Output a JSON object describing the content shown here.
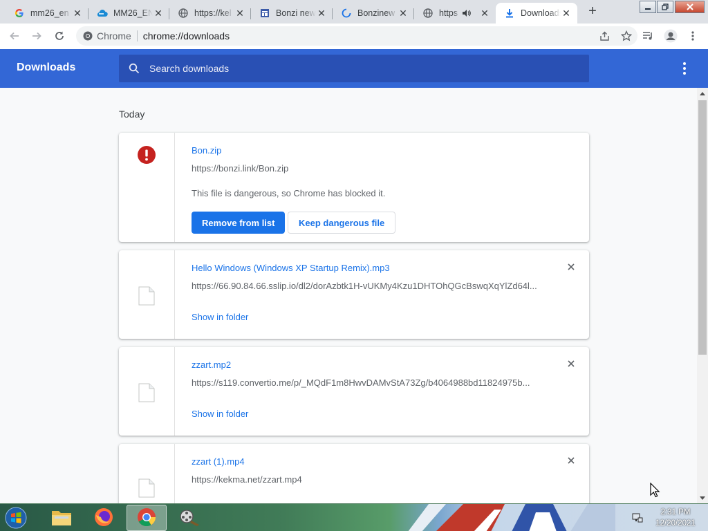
{
  "browser": {
    "tabs": [
      {
        "title": "mm26_en",
        "favicon": "google-g-icon"
      },
      {
        "title": "MM26_EN",
        "favicon": "cloud-icon"
      },
      {
        "title": "https://kel",
        "favicon": "globe-icon"
      },
      {
        "title": "Bonzi new",
        "favicon": "window-icon"
      },
      {
        "title": "Bonzinew",
        "favicon": "loading-spinner-icon"
      },
      {
        "title": "https",
        "favicon": "globe-icon"
      },
      {
        "title": "Downloads",
        "favicon": "download-icon"
      }
    ],
    "omnibox": {
      "scheme_label": "Chrome",
      "url": "chrome://downloads"
    }
  },
  "downloads_page": {
    "title": "Downloads",
    "search_placeholder": "Search downloads",
    "section_label": "Today",
    "items": [
      {
        "name": "Bon.zip",
        "url": "https://bonzi.link/Bon.zip",
        "warning": "This file is dangerous, so Chrome has blocked it.",
        "primary_action": "Remove from list",
        "secondary_action": "Keep dangerous file",
        "icon": "danger-icon"
      },
      {
        "name": "Hello Windows (Windows XP Startup Remix).mp3",
        "url": "https://66.90.84.66.sslip.io/dl2/dorAzbtk1H-vUKMy4Kzu1DHTOhQGcBswqXqYlZd64l...",
        "action": "Show in folder",
        "icon": "file-icon"
      },
      {
        "name": "zzart.mp2",
        "url": "https://s119.convertio.me/p/_MQdF1m8HwvDAMvStA73Zg/b4064988bd11824975b...",
        "action": "Show in folder",
        "icon": "file-icon"
      },
      {
        "name": "zzart (1).mp4",
        "url": "https://kekma.net/zzart.mp4",
        "icon": "file-icon"
      }
    ]
  },
  "taskbar": {
    "time": "2:31 PM",
    "date": "12/20/2021",
    "apps": [
      "windows-explorer",
      "firefox",
      "chrome",
      "video-maker"
    ]
  },
  "colors": {
    "header_blue": "#3367d6",
    "search_blue": "#2950b4",
    "link_blue": "#1a73e8",
    "danger_red": "#c5221f"
  }
}
